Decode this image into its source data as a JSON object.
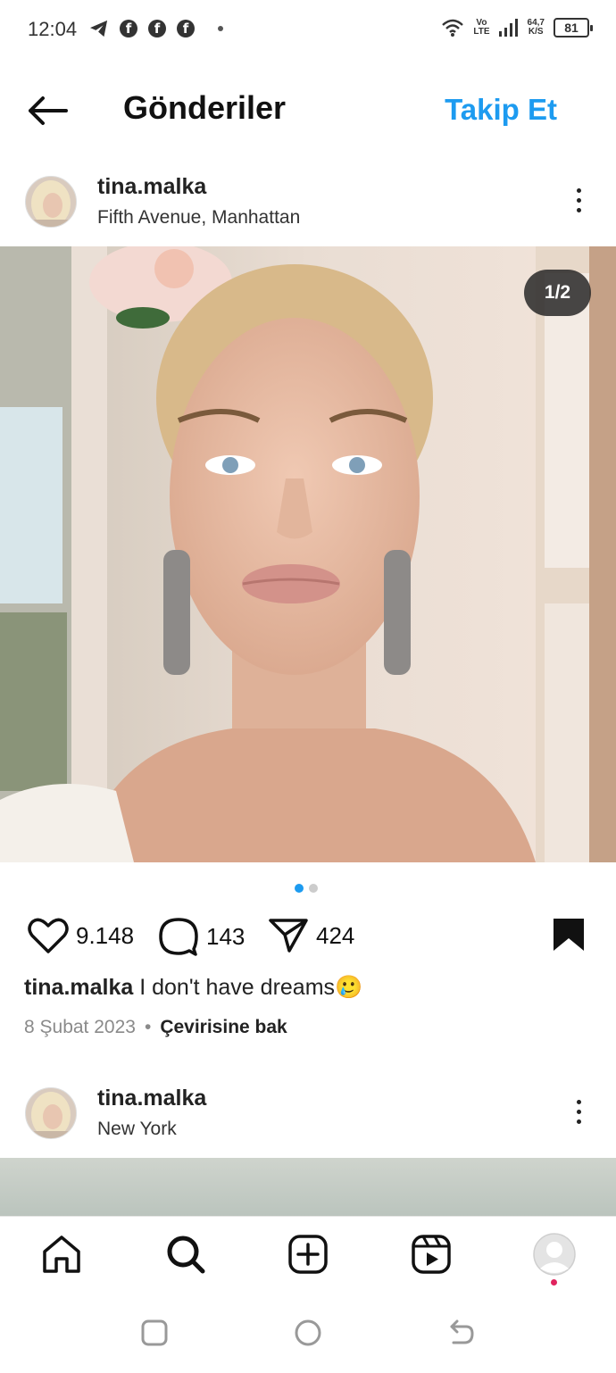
{
  "status": {
    "time": "12:04",
    "network_top": "Vo",
    "network_bottom": "LTE",
    "speed_top": "64,7",
    "speed_bottom": "K/S",
    "battery": "81"
  },
  "header": {
    "title": "Gönderiler",
    "follow_label": "Takip Et"
  },
  "post1": {
    "username": "tina.malka",
    "location": "Fifth Avenue, Manhattan",
    "image_counter": "1/2",
    "likes": "9.148",
    "comments": "143",
    "shares": "424",
    "caption_user": "tina.malka",
    "caption_text": "I don't have dreams🥲",
    "date": "8 Şubat 2023",
    "separator": "•",
    "translate_label": "Çevirisine bak"
  },
  "post2": {
    "username": "tina.malka",
    "location": "New York"
  },
  "colors": {
    "accent": "#1d9bf0",
    "notification_dot": "#e0245e"
  }
}
